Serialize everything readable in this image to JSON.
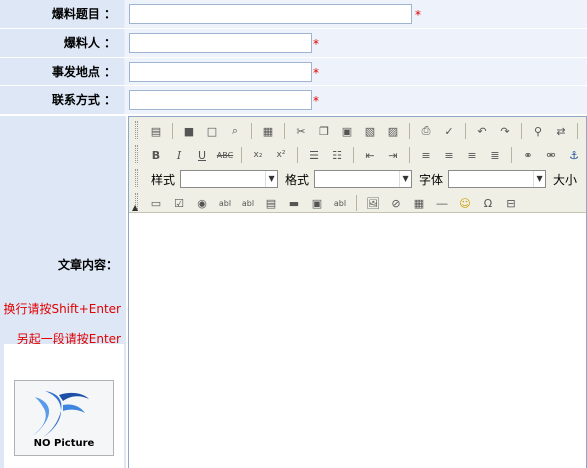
{
  "form": {
    "fields": [
      {
        "label": "爆料题目 ：",
        "value": "",
        "required": "*"
      },
      {
        "label": "爆料人 ：",
        "value": "",
        "required": "*"
      },
      {
        "label": "事发地点 ：",
        "value": "",
        "required": "*"
      },
      {
        "label": "联系方式 ：",
        "value": "",
        "required": "*"
      }
    ],
    "content_label": "文章内容：",
    "hint_newline": "换行请按Shift+Enter",
    "hint_paragraph": "另起一段请按Enter",
    "picture_caption": "NO Picture"
  },
  "editor": {
    "style_label": "样式",
    "format_label": "格式",
    "font_label": "字体",
    "size_label": "大小",
    "style_value": "",
    "format_value": "",
    "font_value": "",
    "toolbar_row1": [
      "source-icon",
      "save-icon",
      "new-page-icon",
      "preview-icon",
      "templates-icon",
      "cut-icon",
      "copy-icon",
      "paste-icon",
      "paste-text-icon",
      "paste-word-icon",
      "print-icon",
      "spellcheck-icon",
      "undo-icon",
      "redo-icon",
      "find-icon",
      "replace-icon",
      "select-all-icon"
    ],
    "toolbar_row2": [
      "bold-icon",
      "italic-icon",
      "underline-icon",
      "strikethrough-icon",
      "subscript-icon",
      "superscript-icon",
      "ordered-list-icon",
      "unordered-list-icon",
      "outdent-icon",
      "indent-icon",
      "align-left-icon",
      "align-center-icon",
      "align-right-icon",
      "align-justify-icon",
      "link-icon",
      "unlink-icon",
      "anchor-icon"
    ],
    "toolbar_row4": [
      "form-icon",
      "checkbox-icon",
      "radio-icon",
      "textfield-icon",
      "textarea-icon",
      "select-icon",
      "button-icon",
      "image-button-icon",
      "hidden-field-icon",
      "image-icon",
      "flash-icon",
      "table-icon",
      "hr-icon",
      "smiley-icon",
      "special-char-icon",
      "page-break-icon"
    ],
    "accent_color": "#e00000",
    "label_bg": "#dde7f6"
  }
}
